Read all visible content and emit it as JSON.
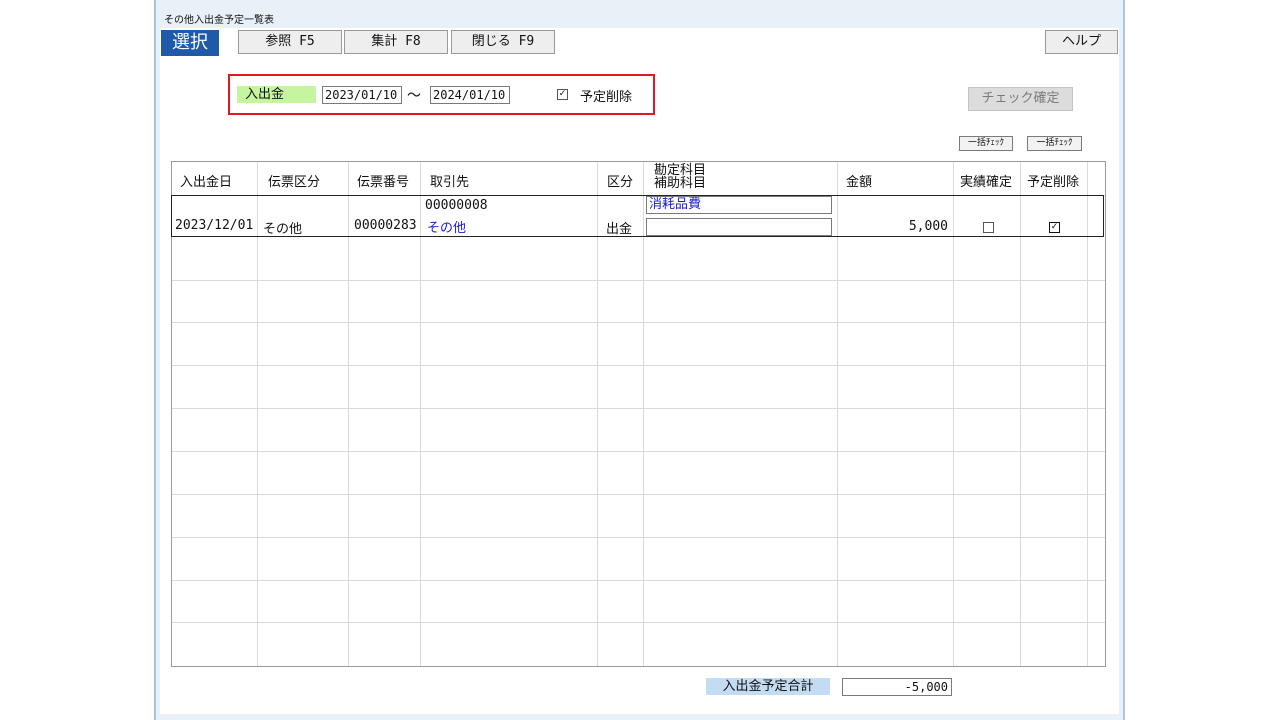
{
  "window": {
    "title": "その他入出金予定一覧表"
  },
  "toolbar": {
    "select_label": "選択",
    "ref_button": "参照 F5",
    "sum_button": "集計 F8",
    "close_button": "閉じる F9",
    "help_button": "ヘルプ",
    "check_confirm_button": "チェック確定",
    "bulk_check_1": "一括ﾁｪｯｸ",
    "bulk_check_2": "一括ﾁｪｯｸ"
  },
  "filter": {
    "type_label": "入出金",
    "date_from": "2023/01/10",
    "tilde": "～",
    "date_to": "2024/01/10",
    "delete_checkbox_mark": "✓",
    "delete_label": "予定削除"
  },
  "table": {
    "headers": {
      "date": "入出金日",
      "slip_type": "伝票区分",
      "slip_no": "伝票番号",
      "partner": "取引先",
      "category": "区分",
      "account_main": "勘定科目",
      "account_sub": "補助科目",
      "amount": "金額",
      "actual_confirm": "実績確定",
      "plan_delete": "予定削除"
    },
    "rows": [
      {
        "date": "2023/12/01",
        "slip_type": "その他",
        "slip_no": "00000283",
        "partner_code": "00000008",
        "partner_name": "その他",
        "category": "出金",
        "account": "消耗品費",
        "sub_account": "",
        "amount": "5,000",
        "actual_mark": "",
        "delete_mark": "✓"
      }
    ]
  },
  "totals": {
    "label": "入出金予定合計",
    "value": "-5,000"
  }
}
